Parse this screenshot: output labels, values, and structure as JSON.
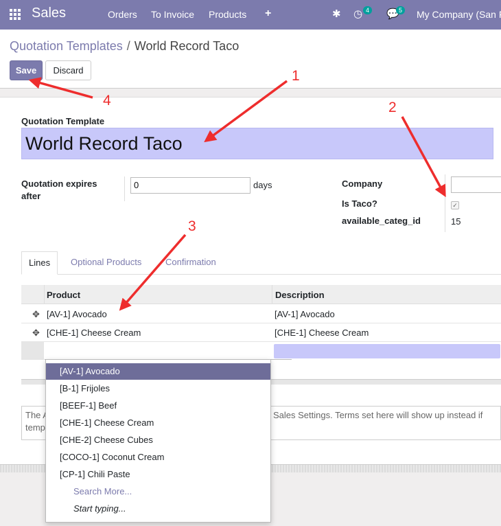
{
  "navbar": {
    "app_name": "Sales",
    "menu": [
      "Orders",
      "To Invoice",
      "Products",
      "+"
    ],
    "activity_count": "4",
    "messages_count": "5",
    "company": "My Company (San F"
  },
  "breadcrumb": {
    "parent": "Quotation Templates",
    "separator": "/",
    "current": "World Record Taco"
  },
  "buttons": {
    "save": "Save",
    "discard": "Discard"
  },
  "form": {
    "template_label": "Quotation Template",
    "template_name": "World Record Taco",
    "expires_label_line1": "Quotation expires",
    "expires_label_line2": "after",
    "expires_value": "0",
    "expires_unit": "days",
    "company_label": "Company",
    "company_value": "",
    "is_taco_label": "Is Taco?",
    "is_taco_checked": true,
    "categ_label": "available_categ_id",
    "categ_value": "15"
  },
  "tabs": [
    {
      "label": "Lines",
      "active": true
    },
    {
      "label": "Optional Products",
      "active": false
    },
    {
      "label": "Confirmation",
      "active": false
    }
  ],
  "lines_table": {
    "columns": [
      "Product",
      "Description"
    ],
    "rows": [
      {
        "product": "[AV-1] Avocado",
        "description": "[AV-1] Avocado"
      },
      {
        "product": "[CHE-1] Cheese Cream",
        "description": "[CHE-1] Cheese Cream"
      }
    ]
  },
  "note": {
    "line1": "The A",
    "line2": "temp",
    "line3": "Sales Settings. Terms set here will show up instead if"
  },
  "dropdown": {
    "items": [
      "[AV-1] Avocado",
      "[B-1] Frijoles",
      "[BEEF-1] Beef",
      "[CHE-1] Cheese Cream",
      "[CHE-2] Cheese Cubes",
      "[COCO-1] Coconut Cream",
      "[CP-1] Chili Paste"
    ],
    "search_more": "Search More...",
    "hint": "Start typing..."
  },
  "annotations": [
    "1",
    "2",
    "3",
    "4"
  ],
  "colors": {
    "brand": "#7c7bad",
    "annotation": "#ee2d2d",
    "input_highlight": "#c8c8fa"
  }
}
